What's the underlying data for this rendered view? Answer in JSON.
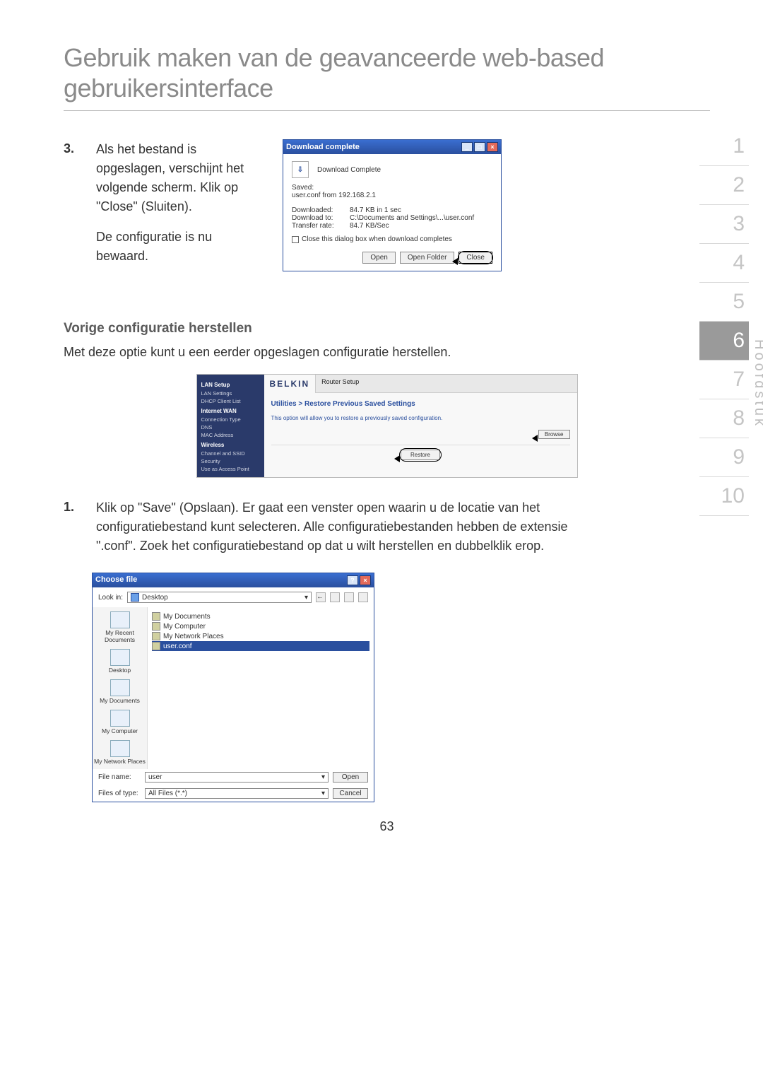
{
  "page_title": "Gebruik maken van de geavanceerde web-based gebruikersinterface",
  "step3": {
    "num": "3.",
    "p1": "Als het bestand is opgeslagen, verschijnt het volgende scherm. Klik op \"Close\" (Sluiten).",
    "p2": "De configuratie is nu bewaard."
  },
  "dl": {
    "title": "Download complete",
    "header_text": "Download Complete",
    "saved_label": "Saved:",
    "saved_value": "user.conf from 192.168.2.1",
    "downloaded_label": "Downloaded:",
    "downloaded_value": "84.7 KB in 1 sec",
    "downloadto_label": "Download to:",
    "downloadto_value": "C:\\Documents and Settings\\...\\user.conf",
    "rate_label": "Transfer rate:",
    "rate_value": "84.7 KB/Sec",
    "checkbox_label": "Close this dialog box when download completes",
    "open": "Open",
    "open_folder": "Open Folder",
    "close": "Close"
  },
  "section": {
    "title": "Vorige configuratie herstellen",
    "desc": "Met deze optie kunt u een eerder opgeslagen configuratie herstellen."
  },
  "belkin": {
    "logo": "BELKIN",
    "topbar": "Router Setup",
    "side_hdr1": "LAN Setup",
    "side_items1": [
      "LAN Settings",
      "DHCP Client List"
    ],
    "side_hdr2": "Internet WAN",
    "side_items2": [
      "Connection Type",
      "DNS",
      "MAC Address"
    ],
    "side_hdr3": "Wireless",
    "side_items3": [
      "Channel and SSID",
      "Security",
      "Use as Access Point"
    ],
    "crumb": "Utilities > Restore Previous Saved Settings",
    "desc": "This option will allow you to restore a previously saved configuration.",
    "browse": "Browse",
    "restore": "Restore"
  },
  "step1": {
    "num": "1.",
    "text": "Klik op \"Save\" (Opslaan). Er gaat een venster open waarin u de locatie van het configuratiebestand kunt selecteren. Alle configuratiebestanden hebben de extensie \".conf\". Zoek het configuratiebestand op dat u wilt herstellen en dubbelklik erop."
  },
  "choose": {
    "title": "Choose file",
    "lookin_label": "Look in:",
    "lookin_value": "Desktop",
    "places": [
      "My Recent Documents",
      "Desktop",
      "My Documents",
      "My Computer",
      "My Network Places"
    ],
    "files": [
      "My Documents",
      "My Computer",
      "My Network Places",
      "user.conf"
    ],
    "filename_label": "File name:",
    "filename_value": "user",
    "filetype_label": "Files of type:",
    "filetype_value": "All Files (*.*)",
    "open": "Open",
    "cancel": "Cancel"
  },
  "sidenav": {
    "items": [
      "1",
      "2",
      "3",
      "4",
      "5",
      "6",
      "7",
      "8",
      "9",
      "10"
    ],
    "active_index": 5,
    "vert": "Hoofdstuk"
  },
  "pagenum": "63"
}
